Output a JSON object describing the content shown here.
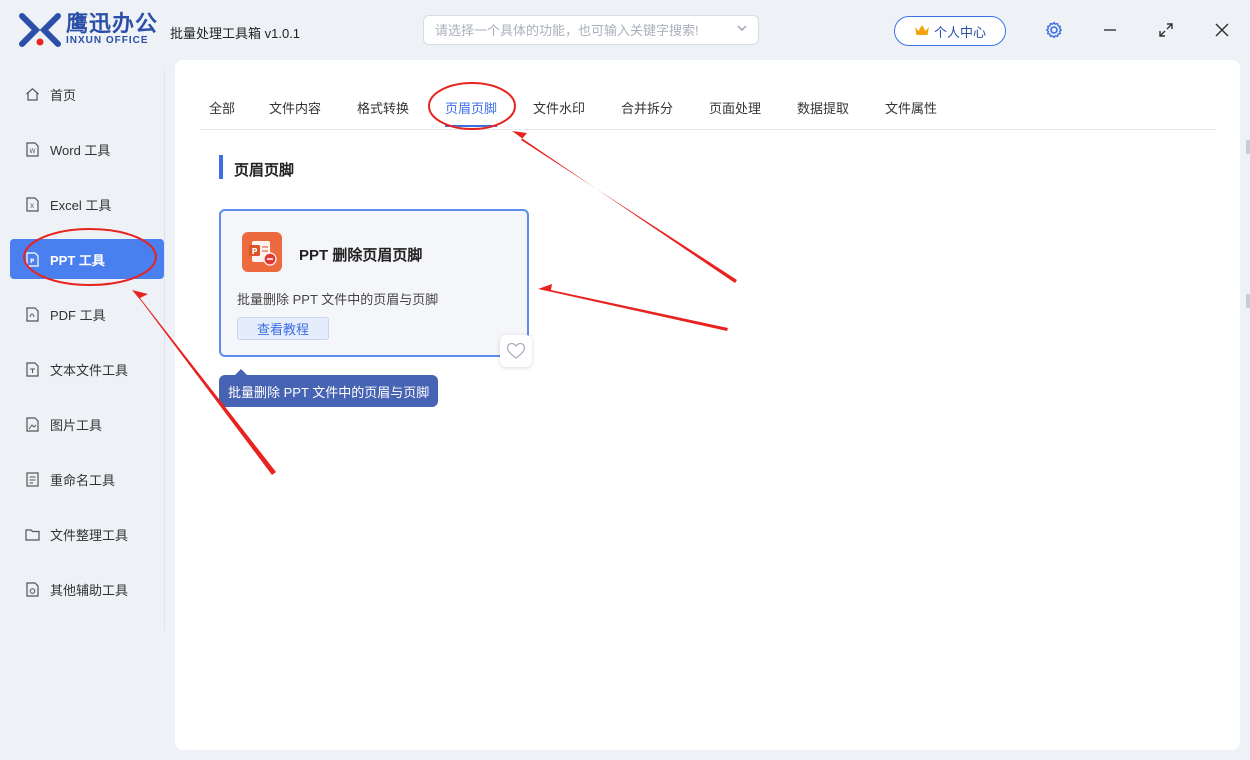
{
  "app": {
    "logo_cn": "鹰迅办公",
    "logo_en": "INXUN OFFICE",
    "title": "批量处理工具箱 v1.0.1"
  },
  "search": {
    "placeholder": "请选择一个具体的功能，也可输入关键字搜索!"
  },
  "header": {
    "user_center": "个人中心"
  },
  "sidebar": {
    "items": [
      {
        "label": "首页",
        "icon": "home-icon"
      },
      {
        "label": "Word 工具",
        "icon": "word-file-icon"
      },
      {
        "label": "Excel 工具",
        "icon": "excel-file-icon"
      },
      {
        "label": "PPT 工具",
        "icon": "ppt-file-icon",
        "active": true
      },
      {
        "label": "PDF 工具",
        "icon": "pdf-file-icon"
      },
      {
        "label": "文本文件工具",
        "icon": "text-file-icon"
      },
      {
        "label": "图片工具",
        "icon": "image-file-icon"
      },
      {
        "label": "重命名工具",
        "icon": "rename-icon"
      },
      {
        "label": "文件整理工具",
        "icon": "folder-icon"
      },
      {
        "label": "其他辅助工具",
        "icon": "tools-icon"
      }
    ]
  },
  "tabs": [
    {
      "label": "全部"
    },
    {
      "label": "文件内容"
    },
    {
      "label": "格式转换"
    },
    {
      "label": "页眉页脚",
      "active": true
    },
    {
      "label": "文件水印"
    },
    {
      "label": "合并拆分"
    },
    {
      "label": "页面处理"
    },
    {
      "label": "数据提取"
    },
    {
      "label": "文件属性"
    }
  ],
  "section": {
    "title": "页眉页脚"
  },
  "card": {
    "title": "PPT 删除页眉页脚",
    "description": "批量删除 PPT 文件中的页眉与页脚",
    "tutorial_button": "查看教程",
    "icon": "ppt-remove-icon"
  },
  "tooltip": {
    "text": "批量删除 PPT 文件中的页眉与页脚"
  },
  "colors": {
    "accent": "#4a7ff0",
    "annotation": "#e8231f",
    "card_icon": "#ec6a3e"
  }
}
